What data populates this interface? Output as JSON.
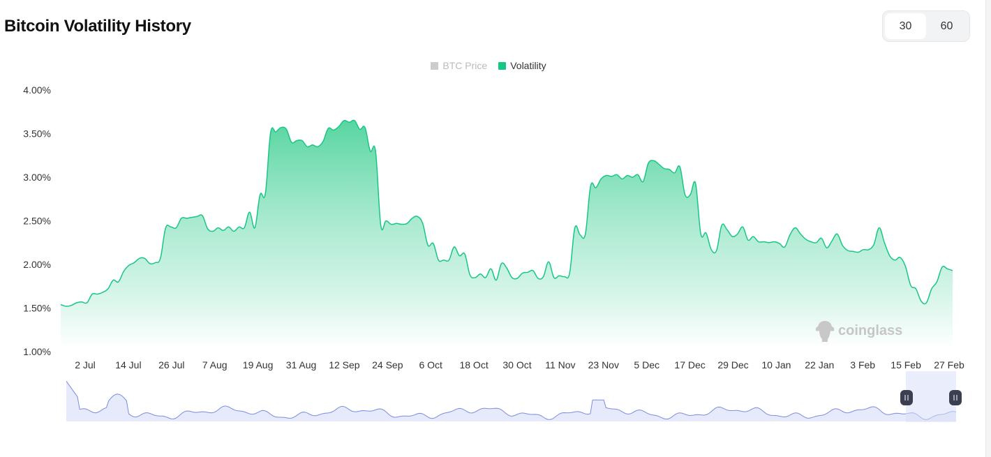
{
  "page": {
    "title": "Bitcoin Volatility History"
  },
  "period_toggle": {
    "options": [
      "30",
      "60"
    ],
    "selected": "30"
  },
  "legend": [
    {
      "label": "BTC Price",
      "active": false,
      "color": "#cccccc"
    },
    {
      "label": "Volatility",
      "active": true,
      "color": "#16c784"
    }
  ],
  "watermark": "coinglass",
  "colors": {
    "line": "#16c784",
    "area_top": "#5ed6a3",
    "area_bottom": "#ffffff",
    "zoom_line": "#6b7fd7",
    "zoom_fill": "#e7eafb",
    "zoom_handle": "#3a3f51"
  },
  "chart_data": {
    "type": "area",
    "title": "Bitcoin Volatility History",
    "xlabel": "",
    "ylabel": "",
    "ylim": [
      1.0,
      4.0
    ],
    "yticks": [
      "1.00%",
      "1.50%",
      "2.00%",
      "2.50%",
      "3.00%",
      "3.50%",
      "4.00%"
    ],
    "xticks": [
      "2 Jul",
      "14 Jul",
      "26 Jul",
      "7 Aug",
      "19 Aug",
      "31 Aug",
      "12 Sep",
      "24 Sep",
      "6 Oct",
      "18 Oct",
      "30 Oct",
      "11 Nov",
      "23 Nov",
      "5 Dec",
      "17 Dec",
      "29 Dec",
      "10 Jan",
      "22 Jan",
      "3 Feb",
      "15 Feb",
      "27 Feb"
    ],
    "grid": false,
    "legend_position": "top-center",
    "series": [
      {
        "name": "Volatility",
        "unit": "%",
        "points": [
          [
            0,
            1.54
          ],
          [
            1,
            1.52
          ],
          [
            2,
            1.53
          ],
          [
            3,
            1.56
          ],
          [
            4,
            1.57
          ],
          [
            5,
            1.56
          ],
          [
            6,
            1.66
          ],
          [
            7,
            1.66
          ],
          [
            8,
            1.68
          ],
          [
            9,
            1.72
          ],
          [
            10,
            1.82
          ],
          [
            11,
            1.8
          ],
          [
            12,
            1.92
          ],
          [
            13,
            1.99
          ],
          [
            14,
            2.02
          ],
          [
            15,
            2.07
          ],
          [
            16,
            2.07
          ],
          [
            17,
            2.01
          ],
          [
            18,
            2.02
          ],
          [
            19,
            2.07
          ],
          [
            20,
            2.42
          ],
          [
            21,
            2.43
          ],
          [
            22,
            2.42
          ],
          [
            23,
            2.53
          ],
          [
            24,
            2.53
          ],
          [
            25,
            2.54
          ],
          [
            26,
            2.55
          ],
          [
            27,
            2.56
          ],
          [
            28,
            2.41
          ],
          [
            29,
            2.38
          ],
          [
            30,
            2.42
          ],
          [
            31,
            2.39
          ],
          [
            32,
            2.43
          ],
          [
            33,
            2.38
          ],
          [
            34,
            2.43
          ],
          [
            35,
            2.42
          ],
          [
            36,
            2.6
          ],
          [
            37,
            2.42
          ],
          [
            38,
            2.8
          ],
          [
            39,
            2.81
          ],
          [
            40,
            3.51
          ],
          [
            41,
            3.52
          ],
          [
            42,
            3.57
          ],
          [
            43,
            3.55
          ],
          [
            44,
            3.4
          ],
          [
            45,
            3.42
          ],
          [
            46,
            3.42
          ],
          [
            47,
            3.35
          ],
          [
            48,
            3.37
          ],
          [
            49,
            3.35
          ],
          [
            50,
            3.41
          ],
          [
            51,
            3.56
          ],
          [
            52,
            3.54
          ],
          [
            53,
            3.58
          ],
          [
            54,
            3.65
          ],
          [
            55,
            3.63
          ],
          [
            56,
            3.65
          ],
          [
            57,
            3.55
          ],
          [
            58,
            3.57
          ],
          [
            59,
            3.3
          ],
          [
            60,
            3.3
          ],
          [
            61,
            2.45
          ],
          [
            62,
            2.5
          ],
          [
            63,
            2.46
          ],
          [
            64,
            2.47
          ],
          [
            65,
            2.46
          ],
          [
            66,
            2.47
          ],
          [
            67,
            2.53
          ],
          [
            68,
            2.55
          ],
          [
            69,
            2.47
          ],
          [
            70,
            2.22
          ],
          [
            71,
            2.24
          ],
          [
            72,
            2.05
          ],
          [
            73,
            2.05
          ],
          [
            74,
            2.05
          ],
          [
            75,
            2.2
          ],
          [
            76,
            2.1
          ],
          [
            77,
            2.12
          ],
          [
            78,
            1.88
          ],
          [
            79,
            1.85
          ],
          [
            80,
            1.89
          ],
          [
            81,
            1.85
          ],
          [
            82,
            1.95
          ],
          [
            83,
            1.82
          ],
          [
            84,
            2.01
          ],
          [
            85,
            1.96
          ],
          [
            86,
            1.85
          ],
          [
            87,
            1.84
          ],
          [
            88,
            1.9
          ],
          [
            89,
            1.91
          ],
          [
            90,
            1.93
          ],
          [
            91,
            1.84
          ],
          [
            92,
            1.86
          ],
          [
            93,
            2.03
          ],
          [
            94,
            1.85
          ],
          [
            95,
            1.87
          ],
          [
            96,
            1.86
          ],
          [
            97,
            1.9
          ],
          [
            98,
            2.42
          ],
          [
            99,
            2.34
          ],
          [
            100,
            2.35
          ],
          [
            101,
            2.9
          ],
          [
            102,
            2.88
          ],
          [
            103,
            2.98
          ],
          [
            104,
            3.02
          ],
          [
            105,
            3.01
          ],
          [
            106,
            3.03
          ],
          [
            107,
            2.98
          ],
          [
            108,
            3.02
          ],
          [
            109,
            3.0
          ],
          [
            110,
            3.03
          ],
          [
            111,
            2.95
          ],
          [
            112,
            3.16
          ],
          [
            113,
            3.19
          ],
          [
            114,
            3.15
          ],
          [
            115,
            3.1
          ],
          [
            116,
            3.09
          ],
          [
            117,
            3.05
          ],
          [
            118,
            3.12
          ],
          [
            119,
            2.8
          ],
          [
            120,
            2.8
          ],
          [
            121,
            2.93
          ],
          [
            122,
            2.35
          ],
          [
            123,
            2.36
          ],
          [
            124,
            2.17
          ],
          [
            125,
            2.16
          ],
          [
            126,
            2.45
          ],
          [
            127,
            2.4
          ],
          [
            128,
            2.32
          ],
          [
            129,
            2.35
          ],
          [
            130,
            2.43
          ],
          [
            131,
            2.28
          ],
          [
            132,
            2.32
          ],
          [
            133,
            2.26
          ],
          [
            134,
            2.26
          ],
          [
            135,
            2.25
          ],
          [
            136,
            2.26
          ],
          [
            137,
            2.24
          ],
          [
            138,
            2.2
          ],
          [
            139,
            2.34
          ],
          [
            140,
            2.42
          ],
          [
            141,
            2.35
          ],
          [
            142,
            2.29
          ],
          [
            143,
            2.26
          ],
          [
            144,
            2.25
          ],
          [
            145,
            2.3
          ],
          [
            146,
            2.19
          ],
          [
            147,
            2.27
          ],
          [
            148,
            2.35
          ],
          [
            149,
            2.22
          ],
          [
            150,
            2.16
          ],
          [
            151,
            2.15
          ],
          [
            152,
            2.14
          ],
          [
            153,
            2.17
          ],
          [
            154,
            2.17
          ],
          [
            155,
            2.23
          ],
          [
            156,
            2.42
          ],
          [
            157,
            2.25
          ],
          [
            158,
            2.1
          ],
          [
            159,
            2.05
          ],
          [
            160,
            2.08
          ],
          [
            161,
            1.98
          ],
          [
            162,
            1.76
          ],
          [
            163,
            1.72
          ],
          [
            164,
            1.58
          ],
          [
            165,
            1.56
          ],
          [
            166,
            1.72
          ],
          [
            167,
            1.8
          ],
          [
            168,
            1.97
          ],
          [
            169,
            1.95
          ],
          [
            170,
            1.93
          ]
        ]
      }
    ]
  }
}
